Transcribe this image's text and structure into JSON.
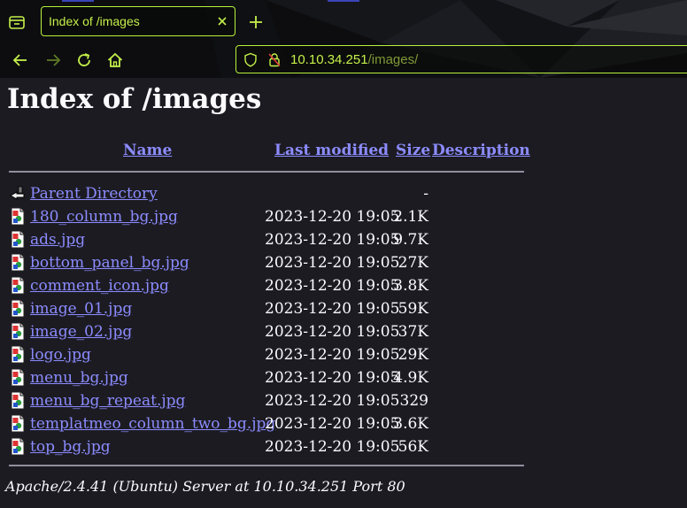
{
  "browser": {
    "tab_title": "Index of /images",
    "url_host": "10.10.34.251",
    "url_path": "/images/",
    "accent_color": "#b6f23d"
  },
  "page": {
    "title": "Index of /images",
    "columns": {
      "name": "Name",
      "last_modified": "Last modified",
      "size": "Size",
      "description": "Description"
    },
    "parent": {
      "name": "Parent Directory",
      "size": "-",
      "icon": "back-arrow-icon"
    },
    "files": [
      {
        "name": "180_column_bg.jpg",
        "modified": "2023-12-20 19:05",
        "size": "2.1K",
        "icon": "image-file-icon"
      },
      {
        "name": "ads.jpg",
        "modified": "2023-12-20 19:05",
        "size": "9.7K",
        "icon": "image-file-icon"
      },
      {
        "name": "bottom_panel_bg.jpg",
        "modified": "2023-12-20 19:05",
        "size": "27K",
        "icon": "image-file-icon"
      },
      {
        "name": "comment_icon.jpg",
        "modified": "2023-12-20 19:05",
        "size": "3.8K",
        "icon": "image-file-icon"
      },
      {
        "name": "image_01.jpg",
        "modified": "2023-12-20 19:05",
        "size": "59K",
        "icon": "image-file-icon"
      },
      {
        "name": "image_02.jpg",
        "modified": "2023-12-20 19:05",
        "size": "37K",
        "icon": "image-file-icon"
      },
      {
        "name": "logo.jpg",
        "modified": "2023-12-20 19:05",
        "size": "29K",
        "icon": "image-file-icon"
      },
      {
        "name": "menu_bg.jpg",
        "modified": "2023-12-20 19:05",
        "size": "4.9K",
        "icon": "image-file-icon"
      },
      {
        "name": "menu_bg_repeat.jpg",
        "modified": "2023-12-20 19:05",
        "size": "329",
        "icon": "image-file-icon"
      },
      {
        "name": "templatmeo_column_two_bg.jpg",
        "modified": "2023-12-20 19:05",
        "size": "3.6K",
        "icon": "image-file-icon"
      },
      {
        "name": "top_bg.jpg",
        "modified": "2023-12-20 19:05",
        "size": "56K",
        "icon": "image-file-icon"
      }
    ],
    "footer": "Apache/2.4.41 (Ubuntu) Server at 10.10.34.251 Port 80",
    "link_color": "#8c8cff"
  }
}
